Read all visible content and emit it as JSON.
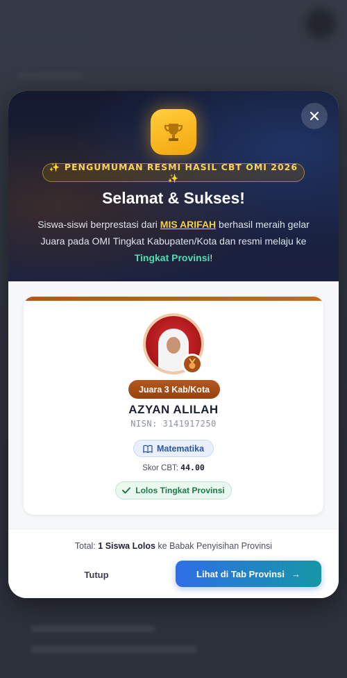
{
  "modal": {
    "close_icon": "close-icon",
    "trophy_icon": "trophy-icon",
    "announcement": "✨ PENGUMUMAN RESMI HASIL CBT OMI 2026 ✨",
    "headline": "Selamat & Sukses!",
    "description": {
      "part1": "Siswa-siswi berprestasi dari ",
      "school": "MIS ARIFAH",
      "part2": " berhasil meraih gelar Juara pada OMI Tingkat Kabupaten/Kota dan resmi melaju ke ",
      "level": "Tingkat Provinsi",
      "part3": "!"
    }
  },
  "student": {
    "rank_badge": "Juara 3 Kab/Kota",
    "medal_icon": "medal-icon",
    "name": "AZYAN ALILAH",
    "nisn": "NISN: 3141917250",
    "subject_icon": "book-icon",
    "subject": "Matematika",
    "score_label": "Skor CBT: ",
    "score_value": "44.00",
    "status_icon": "check-icon",
    "status": "Lolos Tingkat Provinsi"
  },
  "footer": {
    "total_label": "Total: ",
    "total_value": "1 Siswa Lolos",
    "total_suffix": " ke Babak Penyisihan Provinsi",
    "close_button": "Tutup",
    "province_button": "Lihat di Tab Provinsi",
    "arrow_icon": "→"
  },
  "colors": {
    "accent_gold": "#f5cf47",
    "accent_green": "#4fe0b0",
    "rank_bronze": "#b4571d",
    "primary_blue": "#2e6fe6",
    "teal": "#1597a6"
  }
}
